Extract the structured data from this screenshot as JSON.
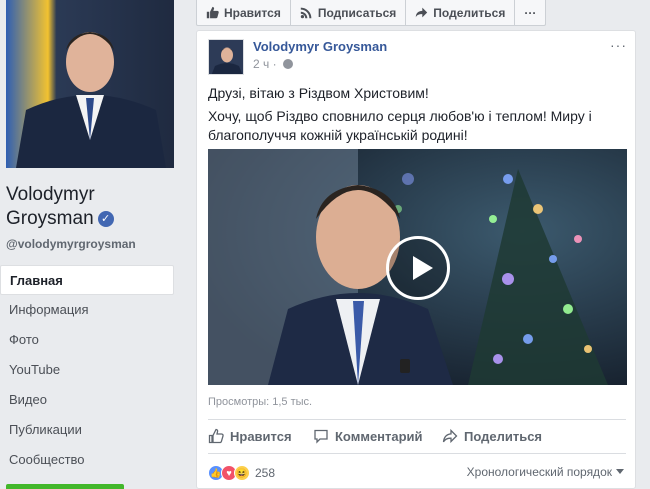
{
  "page": {
    "name": "Volodymyr Groysman",
    "handle": "@volodymyrgroysman"
  },
  "nav": {
    "items": [
      {
        "label": "Главная"
      },
      {
        "label": "Информация"
      },
      {
        "label": "Фото"
      },
      {
        "label": "YouTube"
      },
      {
        "label": "Видео"
      },
      {
        "label": "Публикации"
      },
      {
        "label": "Сообщество"
      }
    ]
  },
  "actionbar": {
    "like_label": "Нравится",
    "subscribe_label": "Подписаться",
    "share_label": "Поделиться",
    "more_label": "···"
  },
  "post": {
    "author": "Volodymyr Groysman",
    "time": "2 ч",
    "more_label": "···",
    "text_line1": "Друзі, вітаю з Різдвом Христовим!",
    "text_line2": "Хочу, щоб Різдво сповнило серця любов'ю і теплом! Миру і благополуччя кожній українській родині!",
    "views": "Просмотры: 1,5 тыс.",
    "actions": {
      "like": "Нравится",
      "comment": "Комментарий",
      "share": "Поделиться"
    },
    "reaction_count": "258",
    "order_label": "Хронологический порядок"
  },
  "colors": {
    "link_blue": "#365899",
    "fb_blue": "#4267b2",
    "green": "#42b72a"
  }
}
